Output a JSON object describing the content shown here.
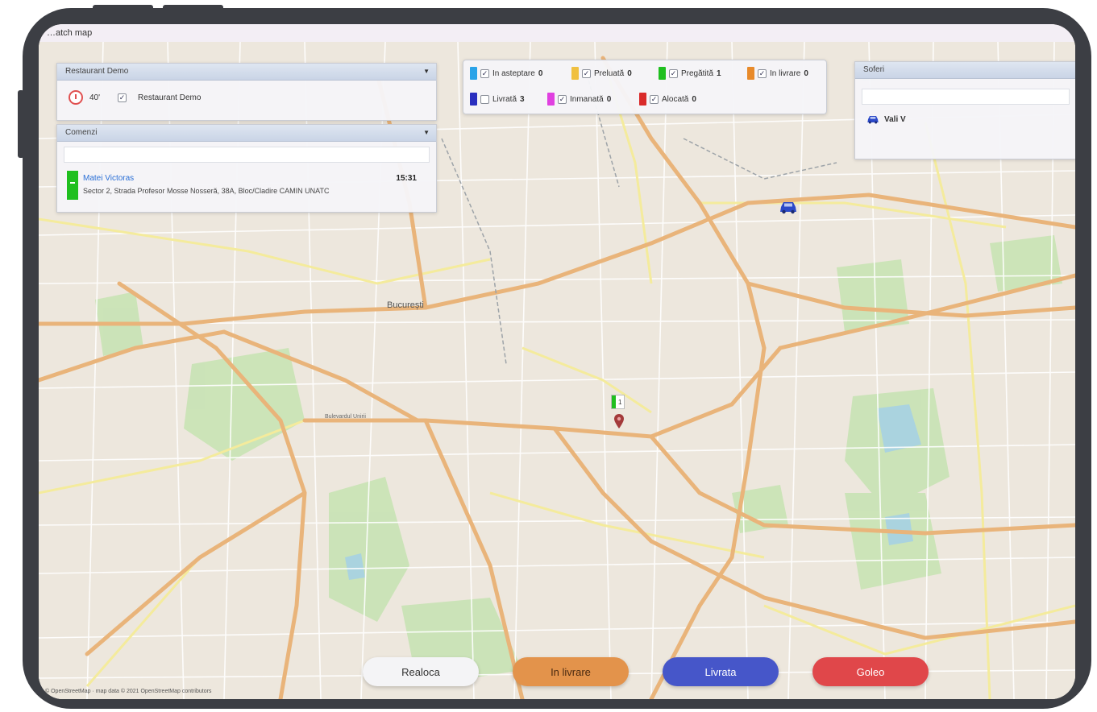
{
  "window": {
    "title": "…atch map"
  },
  "restaurant_panel": {
    "header": "Restaurant Demo",
    "timer_value": "40'",
    "restaurant_name": "Restaurant Demo"
  },
  "orders_panel": {
    "header": "Comenzi",
    "search_placeholder": "",
    "orders": [
      {
        "customer": "Matei Victoras",
        "address": "Sector 2, Strada Profesor Mosse Nosseră, 38A, Bloc/Cladire CAMIN UNATC",
        "time": "15:31",
        "status_color": "#1fbf1f"
      }
    ]
  },
  "status_legend": {
    "items": [
      {
        "label": "In asteptare",
        "count": "0",
        "color": "#2aa3e8",
        "checked": true
      },
      {
        "label": "Preluată",
        "count": "0",
        "color": "#f0c040",
        "checked": true
      },
      {
        "label": "Pregătită",
        "count": "1",
        "color": "#1fbf1f",
        "checked": true
      },
      {
        "label": "In livrare",
        "count": "0",
        "color": "#e88a2a",
        "checked": true
      },
      {
        "label": "Livrată",
        "count": "3",
        "color": "#2a2fbf",
        "checked": false
      },
      {
        "label": "Inmanată",
        "count": "0",
        "color": "#e040e0",
        "checked": true
      },
      {
        "label": "Alocată",
        "count": "0",
        "color": "#d92a2a",
        "checked": true
      }
    ]
  },
  "drivers_panel": {
    "header": "Soferi",
    "search_placeholder": "",
    "drivers": [
      {
        "name": "Vali V",
        "icon": "car-icon"
      }
    ]
  },
  "map": {
    "city_label": "București",
    "street_label": "Bulevardul Unirii",
    "order_marker_label": "1",
    "attribution": "© OpenStreetMap · map data © 2021 OpenStreetMap contributors"
  },
  "actions": {
    "realoca": "Realoca",
    "in_livrare": "In livrare",
    "livrata": "Livrata",
    "goleste": "Goleo"
  },
  "colors": {
    "btn_realoca": "#f4f4f6",
    "btn_in_livrare": "#e3934b",
    "btn_livrata": "#4656c9",
    "btn_goleste": "#e0474a",
    "driver_car": "#2b49c8"
  }
}
